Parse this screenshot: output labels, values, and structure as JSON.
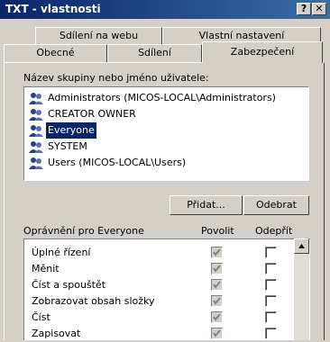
{
  "window": {
    "title": "TXT - vlastnosti",
    "help_btn": "?",
    "close_btn": "✕"
  },
  "tabs_top": [
    {
      "label": "Sdílení na webu"
    },
    {
      "label": "Vlastní nastavení"
    }
  ],
  "tabs_bottom": [
    {
      "label": "Obecné"
    },
    {
      "label": "Sdílení"
    },
    {
      "label": "Zabezpečení"
    }
  ],
  "group_label": "Název skupiny nebo jméno uživatele:",
  "users": [
    {
      "name": "Administrators (MICOS-LOCAL\\Administrators)",
      "selected": false
    },
    {
      "name": "CREATOR OWNER",
      "selected": false
    },
    {
      "name": "Everyone",
      "selected": true
    },
    {
      "name": "SYSTEM",
      "selected": false
    },
    {
      "name": "Users (MICOS-LOCAL\\Users)",
      "selected": false
    }
  ],
  "buttons": {
    "add": "Přidat...",
    "remove": "Odebrat"
  },
  "permissions": {
    "title": "Oprávnění pro Everyone",
    "allow_label": "Povolit",
    "deny_label": "Odepřít",
    "rows": [
      {
        "label": "Úplné řízení",
        "allow": true,
        "deny": false
      },
      {
        "label": "Měnit",
        "allow": true,
        "deny": false
      },
      {
        "label": "Číst a spouštět",
        "allow": true,
        "deny": false
      },
      {
        "label": "Zobrazovat obsah složky",
        "allow": true,
        "deny": false
      },
      {
        "label": "Číst",
        "allow": true,
        "deny": false
      },
      {
        "label": "Zapisovat",
        "allow": true,
        "deny": false
      }
    ]
  },
  "icons": {
    "user": "users-icon",
    "check": "checkmark-icon"
  }
}
